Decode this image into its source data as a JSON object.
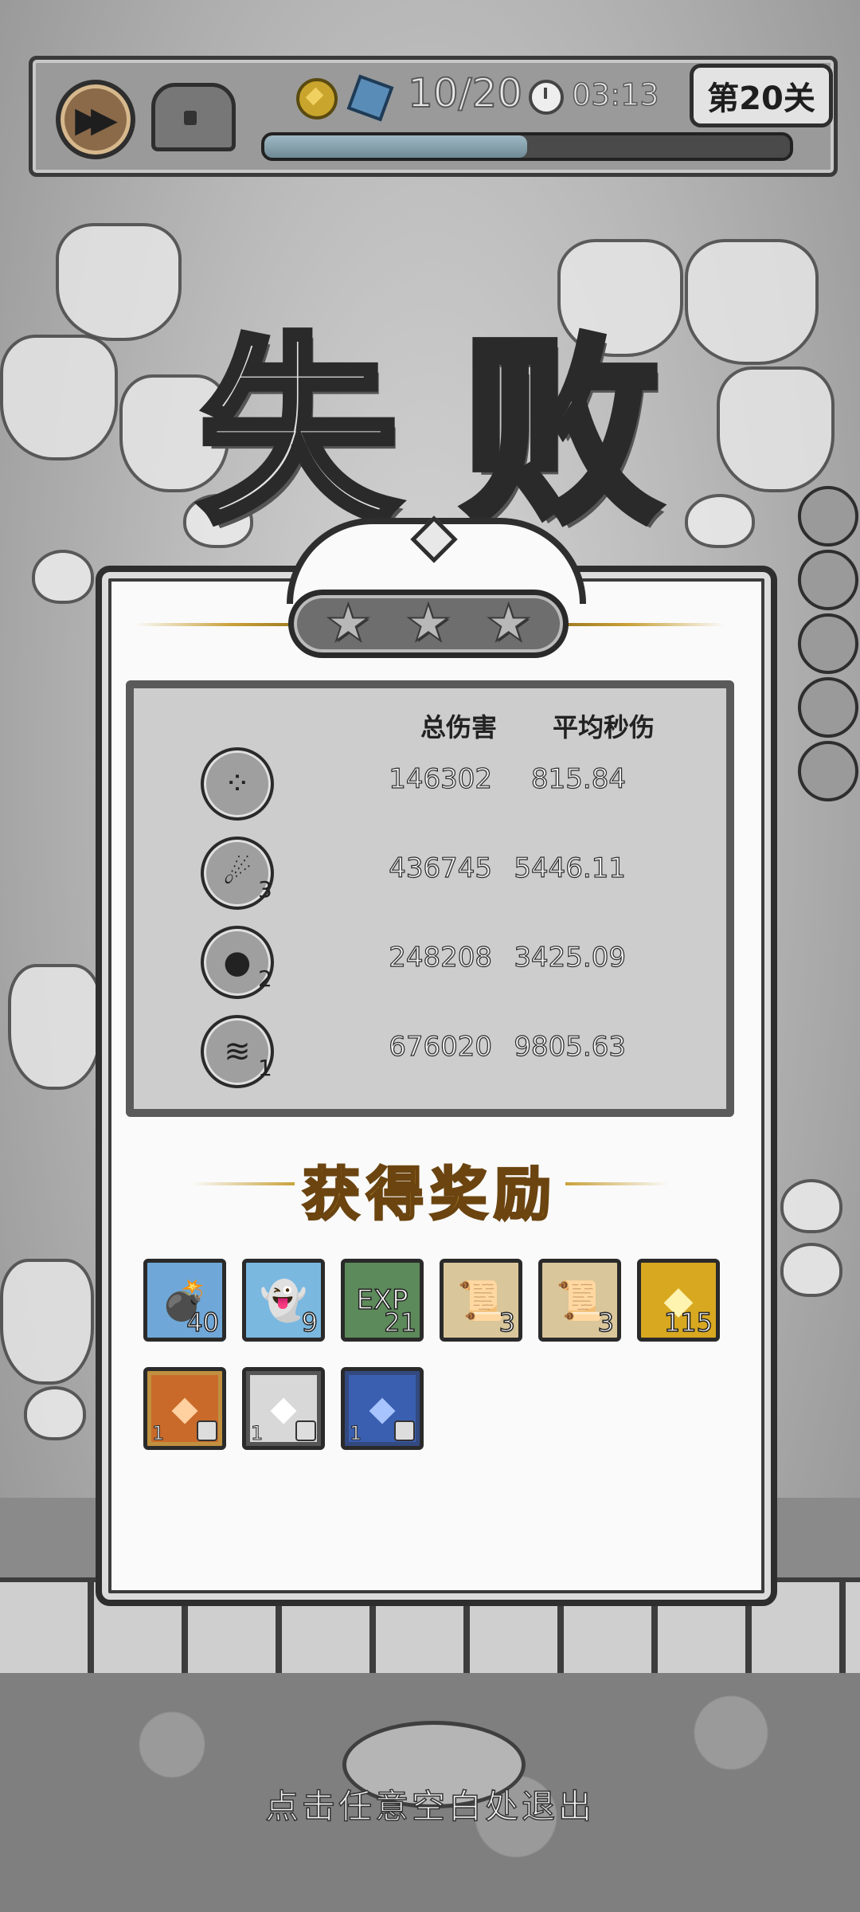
{
  "hud": {
    "wave": "10/20",
    "timer": "03:13",
    "level": "第20关",
    "wave_progress": 0.5,
    "icons": [
      "fast-forward-icon",
      "chest-icon",
      "coin-icon",
      "gem-icon",
      "clock-icon"
    ]
  },
  "result": {
    "title": "失败",
    "stars_earned": 0,
    "stars_total": 3,
    "headers": {
      "total_damage": "总伤害",
      "avg_dps": "平均秒伤"
    },
    "skills": [
      {
        "icon": "seed-shot-icon",
        "level": "",
        "total_damage": "146302",
        "avg_dps": "815.84"
      },
      {
        "icon": "comet-icon",
        "level": "3",
        "total_damage": "436745",
        "avg_dps": "5446.11"
      },
      {
        "icon": "bomb-icon",
        "level": "2",
        "total_damage": "248208",
        "avg_dps": "3425.09"
      },
      {
        "icon": "whirlwind-icon",
        "level": "1",
        "total_damage": "676020",
        "avg_dps": "9805.63"
      }
    ]
  },
  "rewards": {
    "title": "获得奖励",
    "items": [
      {
        "icon": "bomb-gem-icon",
        "count": "40",
        "color": "#6fa8d8"
      },
      {
        "icon": "ghost-gem-icon",
        "count": "9",
        "color": "#7ab8e0"
      },
      {
        "icon": "exp-icon",
        "label": "EXP",
        "count": "21",
        "color": "#5d8a5a"
      },
      {
        "icon": "scroll-icon",
        "count": "3",
        "color": "#d9c69a"
      },
      {
        "icon": "scroll-icon",
        "count": "3",
        "color": "#d9c69a"
      },
      {
        "icon": "gold-coin-icon",
        "count": "115",
        "color": "#d8a820"
      }
    ],
    "materials": [
      {
        "icon": "orange-crystal-icon",
        "level": "1",
        "color": "#c96a2a",
        "frame": "#c09040"
      },
      {
        "icon": "white-crystal-icon",
        "level": "1",
        "color": "#d8d8d8",
        "frame": "#555555"
      },
      {
        "icon": "blue-crystal-icon",
        "level": "1",
        "color": "#3a5fb0",
        "frame": "#334a80"
      }
    ]
  },
  "footer": {
    "exit_hint": "点击任意空白处退出"
  }
}
